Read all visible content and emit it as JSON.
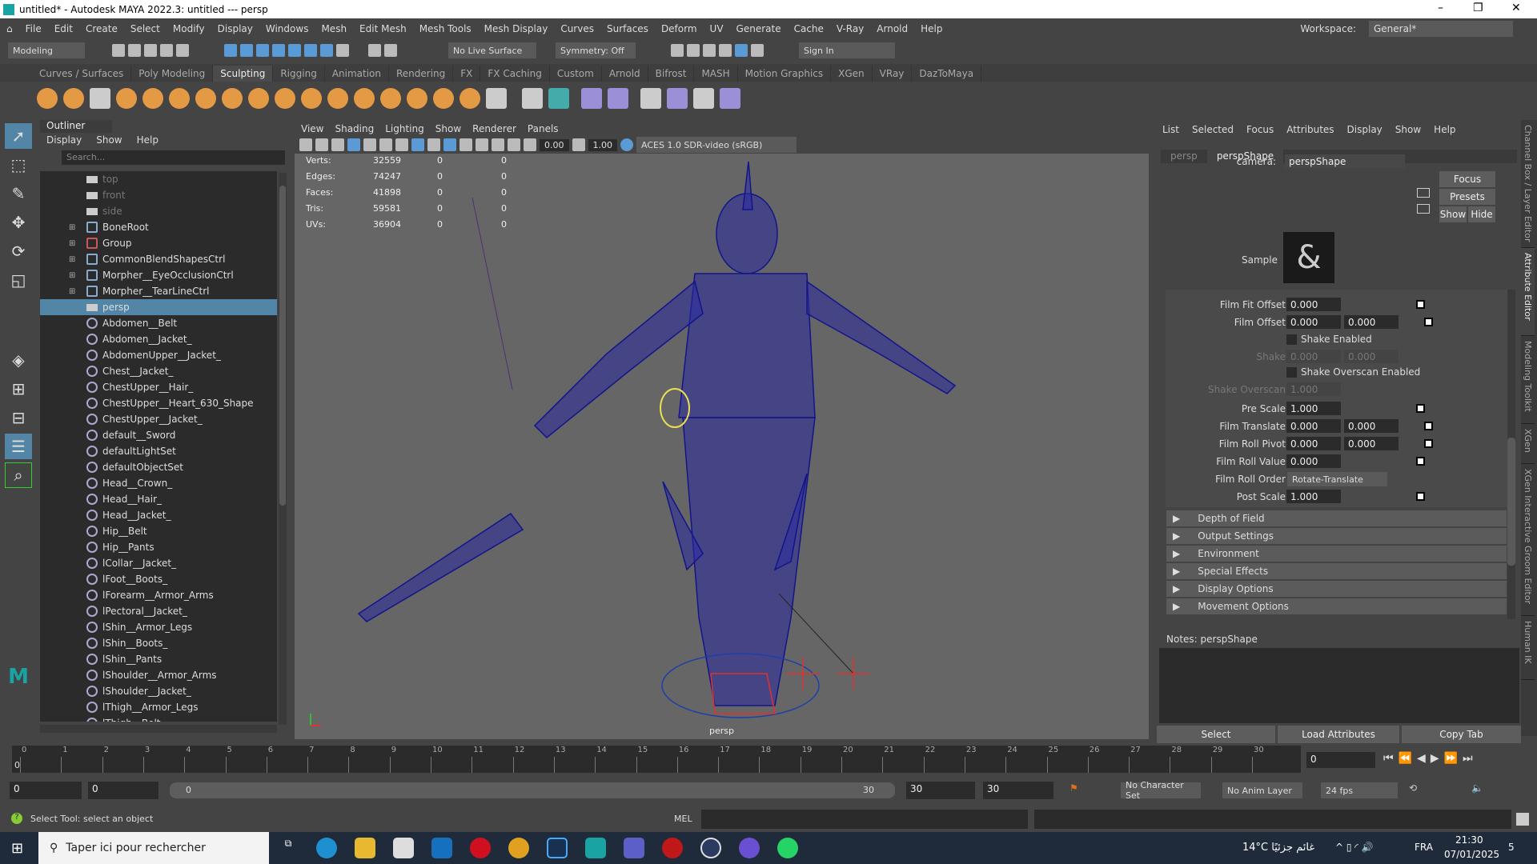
{
  "window": {
    "title": "untitled* - Autodesk MAYA 2022.3: untitled   ---   persp",
    "controls": [
      "–",
      "❐",
      "✕"
    ]
  },
  "menubar": {
    "items": [
      "File",
      "Edit",
      "Create",
      "Select",
      "Modify",
      "Display",
      "Windows",
      "Mesh",
      "Edit Mesh",
      "Mesh Tools",
      "Mesh Display",
      "Curves",
      "Surfaces",
      "Deform",
      "UV",
      "Generate",
      "Cache",
      "V-Ray",
      "Arnold",
      "Help"
    ],
    "workspace_label": "Workspace:",
    "workspace_value": "General*"
  },
  "statusline": {
    "mode": "Modeling",
    "live_surface": "No Live Surface",
    "symmetry": "Symmetry: Off",
    "sign_in": "Sign In"
  },
  "shelf": {
    "tabs": [
      "Curves / Surfaces",
      "Poly Modeling",
      "Sculpting",
      "Rigging",
      "Animation",
      "Rendering",
      "FX",
      "FX Caching",
      "Custom",
      "Arnold",
      "Bifrost",
      "MASH",
      "Motion Graphics",
      "XGen",
      "VRay",
      "DazToMaya"
    ],
    "active": "Sculpting"
  },
  "outliner": {
    "title": "Outliner",
    "menu": [
      "Display",
      "Show",
      "Help"
    ],
    "search_placeholder": "Search...",
    "items": [
      {
        "label": "top",
        "type": "camera",
        "dim": true
      },
      {
        "label": "front",
        "type": "camera",
        "dim": true
      },
      {
        "label": "side",
        "type": "camera",
        "dim": true
      },
      {
        "label": "BoneRoot",
        "type": "joint",
        "expand": true
      },
      {
        "label": "Group",
        "type": "group",
        "expand": true
      },
      {
        "label": "CommonBlendShapesCtrl",
        "type": "curve",
        "expand": true
      },
      {
        "label": "Morpher__EyeOcclusionCtrl",
        "type": "curve",
        "expand": true
      },
      {
        "label": "Morpher__TearLineCtrl",
        "type": "curve",
        "expand": true
      },
      {
        "label": "persp",
        "type": "camera",
        "selected": true
      },
      {
        "label": "Abdomen__Belt"
      },
      {
        "label": "Abdomen__Jacket_"
      },
      {
        "label": "AbdomenUpper__Jacket_"
      },
      {
        "label": "Chest__Jacket_"
      },
      {
        "label": "ChestUpper__Hair_"
      },
      {
        "label": "ChestUpper__Heart_630_Shape"
      },
      {
        "label": "ChestUpper__Jacket_"
      },
      {
        "label": "default__Sword"
      },
      {
        "label": "defaultLightSet"
      },
      {
        "label": "defaultObjectSet"
      },
      {
        "label": "Head__Crown_"
      },
      {
        "label": "Head__Hair_"
      },
      {
        "label": "Head__Jacket_"
      },
      {
        "label": "Hip__Belt"
      },
      {
        "label": "Hip__Pants"
      },
      {
        "label": "lCollar__Jacket_"
      },
      {
        "label": "lFoot__Boots_"
      },
      {
        "label": "lForearm__Armor_Arms"
      },
      {
        "label": "lPectoral__Jacket_"
      },
      {
        "label": "lShin__Armor_Legs"
      },
      {
        "label": "lShin__Boots_"
      },
      {
        "label": "lShin__Pants"
      },
      {
        "label": "lShoulder__Armor_Arms"
      },
      {
        "label": "lShoulder__Jacket_"
      },
      {
        "label": "lThigh__Armor_Legs"
      },
      {
        "label": "lThigh__Belt"
      }
    ]
  },
  "viewport": {
    "menu": [
      "View",
      "Shading",
      "Lighting",
      "Show",
      "Renderer",
      "Panels"
    ],
    "exposure": "0.00",
    "gamma": "1.00",
    "color_space": "ACES 1.0 SDR-video (sRGB)",
    "camera_label": "persp",
    "hud": [
      [
        "Verts:",
        "32559",
        "0",
        "0"
      ],
      [
        "Edges:",
        "74247",
        "0",
        "0"
      ],
      [
        "Faces:",
        "41898",
        "0",
        "0"
      ],
      [
        "Tris:",
        "59581",
        "0",
        "0"
      ],
      [
        "UVs:",
        "36904",
        "0",
        "0"
      ]
    ]
  },
  "attribute_editor": {
    "menu": [
      "List",
      "Selected",
      "Focus",
      "Attributes",
      "Display",
      "Show",
      "Help"
    ],
    "tabs": [
      "persp",
      "perspShape"
    ],
    "active_tab": "perspShape",
    "camera_label": "camera:",
    "camera_value": "perspShape",
    "buttons": {
      "focus": "Focus",
      "presets": "Presets",
      "show": "Show",
      "hide": "Hide"
    },
    "sample_label": "Sample",
    "attrs": {
      "film_fit_offset": {
        "label": "Film Fit Offset",
        "v": "0.000"
      },
      "film_offset": {
        "label": "Film Offset",
        "v1": "0.000",
        "v2": "0.000"
      },
      "shake_enabled": "Shake Enabled",
      "shake": {
        "label": "Shake",
        "v1": "0.000",
        "v2": "0.000"
      },
      "shake_overscan_enabled": "Shake Overscan Enabled",
      "shake_overscan": {
        "label": "Shake Overscan",
        "v": "1.000"
      },
      "pre_scale": {
        "label": "Pre Scale",
        "v": "1.000"
      },
      "film_translate": {
        "label": "Film Translate",
        "v1": "0.000",
        "v2": "0.000"
      },
      "film_roll_pivot": {
        "label": "Film Roll Pivot",
        "v1": "0.000",
        "v2": "0.000"
      },
      "film_roll_value": {
        "label": "Film Roll Value",
        "v": "0.000"
      },
      "film_roll_order": {
        "label": "Film Roll Order",
        "v": "Rotate-Translate"
      },
      "post_scale": {
        "label": "Post Scale",
        "v": "1.000"
      }
    },
    "sections": [
      "Depth of Field",
      "Output Settings",
      "Environment",
      "Special Effects",
      "Display Options",
      "Movement Options"
    ],
    "notes_label": "Notes:  perspShape",
    "bottom_buttons": [
      "Select",
      "Load Attributes",
      "Copy Tab"
    ]
  },
  "side_tabs": [
    "Channel Box / Layer Editor",
    "Attribute Editor",
    "Modeling Toolkit",
    "XGen",
    "XGen Interactive Groom Editor",
    "Human IK"
  ],
  "timeline": {
    "ticks": [
      "0",
      "1",
      "2",
      "3",
      "4",
      "5",
      "6",
      "7",
      "8",
      "9",
      "10",
      "11",
      "12",
      "13",
      "14",
      "15",
      "16",
      "17",
      "18",
      "19",
      "20",
      "21",
      "22",
      "23",
      "24",
      "25",
      "26",
      "27",
      "28",
      "29",
      "30"
    ],
    "current": "0",
    "current_field": "0"
  },
  "range": {
    "start": "0",
    "inner_start": "0",
    "slider_start": "0",
    "slider_end": "30",
    "inner_end": "30",
    "end": "30",
    "character_set": "No Character Set",
    "anim_layer": "No Anim Layer",
    "fps": "24 fps"
  },
  "commandline": {
    "help": "Select Tool: select an object",
    "mel": "MEL"
  },
  "taskbar": {
    "search": "Taper ici pour rechercher",
    "weather": "14°C  غائم جزئيًا",
    "lang": "FRA",
    "time": "21:30",
    "date": "07/01/2025",
    "notif": "5"
  }
}
